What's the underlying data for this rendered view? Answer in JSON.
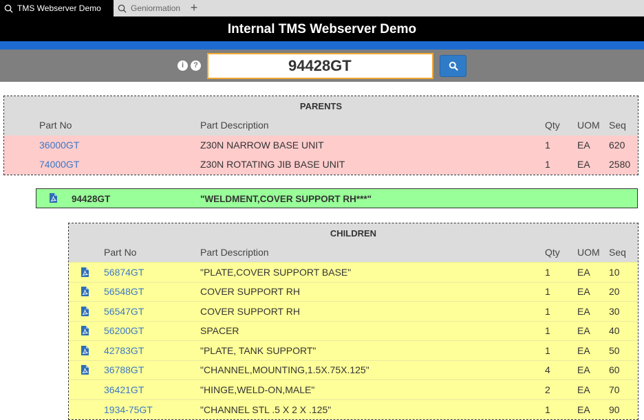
{
  "browser": {
    "tabs": [
      {
        "title": "TMS Webserver Demo",
        "active": true
      },
      {
        "title": "Geniormation",
        "active": false
      }
    ],
    "new_tab": "+"
  },
  "app": {
    "title": "Internal TMS Webserver Demo",
    "info_icon": "info-icon",
    "help_icon": "help-icon",
    "search_value": "94428GT",
    "search_button_icon": "search-icon"
  },
  "parents": {
    "title": "PARENTS",
    "headers": {
      "part_no": "Part No",
      "description": "Part Description",
      "qty": "Qty",
      "uom": "UOM",
      "seq": "Seq"
    },
    "rows": [
      {
        "part_no": "36000GT",
        "description": "Z30N NARROW BASE UNIT",
        "qty": "1",
        "uom": "EA",
        "seq": "620"
      },
      {
        "part_no": "74000GT",
        "description": "Z30N ROTATING JIB BASE UNIT",
        "qty": "1",
        "uom": "EA",
        "seq": "2580"
      }
    ]
  },
  "current": {
    "part_no": "94428GT",
    "description": "\"WELDMENT,COVER SUPPORT RH***\"",
    "icon": "pdf-icon"
  },
  "children": {
    "title": "CHILDREN",
    "headers": {
      "part_no": "Part No",
      "description": "Part Description",
      "qty": "Qty",
      "uom": "UOM",
      "seq": "Seq"
    },
    "rows": [
      {
        "pdf": true,
        "part_no": "56874GT",
        "description": "\"PLATE,COVER SUPPORT BASE\"",
        "qty": "1",
        "uom": "EA",
        "seq": "10"
      },
      {
        "pdf": true,
        "part_no": "56548GT",
        "description": "COVER SUPPORT RH",
        "qty": "1",
        "uom": "EA",
        "seq": "20"
      },
      {
        "pdf": true,
        "part_no": "56547GT",
        "description": "COVER SUPPORT RH",
        "qty": "1",
        "uom": "EA",
        "seq": "30"
      },
      {
        "pdf": true,
        "part_no": "56200GT",
        "description": "SPACER",
        "qty": "1",
        "uom": "EA",
        "seq": "40"
      },
      {
        "pdf": true,
        "part_no": "42783GT",
        "description": "\"PLATE, TANK SUPPORT\"",
        "qty": "1",
        "uom": "EA",
        "seq": "50"
      },
      {
        "pdf": true,
        "part_no": "36788GT",
        "description": "\"CHANNEL,MOUNTING,1.5X.75X.125\"",
        "qty": "4",
        "uom": "EA",
        "seq": "60"
      },
      {
        "pdf": false,
        "part_no": "36421GT",
        "description": "\"HINGE,WELD-ON,MALE\"",
        "qty": "2",
        "uom": "EA",
        "seq": "70"
      },
      {
        "pdf": false,
        "part_no": "1934-75GT",
        "description": "\"CHANNEL STL .5 X 2 X .125\"",
        "qty": "1",
        "uom": "EA",
        "seq": "90"
      }
    ]
  },
  "colors": {
    "header_bg": "#000000",
    "accent_blue": "#1d6bd0",
    "parent_row": "#ffcccc",
    "current_row": "#99ff99",
    "child_row": "#ffff99",
    "link": "#3b78c4"
  }
}
